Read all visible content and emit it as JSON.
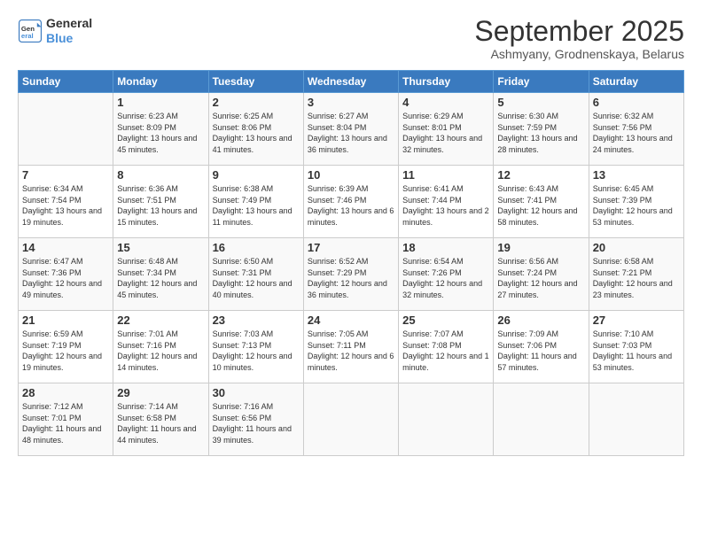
{
  "logo": {
    "line1": "General",
    "line2": "Blue"
  },
  "title": "September 2025",
  "subtitle": "Ashmyany, Grodnenskaya, Belarus",
  "days_of_week": [
    "Sunday",
    "Monday",
    "Tuesday",
    "Wednesday",
    "Thursday",
    "Friday",
    "Saturday"
  ],
  "weeks": [
    [
      {
        "day": "",
        "sunrise": "",
        "sunset": "",
        "daylight": ""
      },
      {
        "day": "1",
        "sunrise": "6:23 AM",
        "sunset": "8:09 PM",
        "daylight": "13 hours and 45 minutes."
      },
      {
        "day": "2",
        "sunrise": "6:25 AM",
        "sunset": "8:06 PM",
        "daylight": "13 hours and 41 minutes."
      },
      {
        "day": "3",
        "sunrise": "6:27 AM",
        "sunset": "8:04 PM",
        "daylight": "13 hours and 36 minutes."
      },
      {
        "day": "4",
        "sunrise": "6:29 AM",
        "sunset": "8:01 PM",
        "daylight": "13 hours and 32 minutes."
      },
      {
        "day": "5",
        "sunrise": "6:30 AM",
        "sunset": "7:59 PM",
        "daylight": "13 hours and 28 minutes."
      },
      {
        "day": "6",
        "sunrise": "6:32 AM",
        "sunset": "7:56 PM",
        "daylight": "13 hours and 24 minutes."
      }
    ],
    [
      {
        "day": "7",
        "sunrise": "6:34 AM",
        "sunset": "7:54 PM",
        "daylight": "13 hours and 19 minutes."
      },
      {
        "day": "8",
        "sunrise": "6:36 AM",
        "sunset": "7:51 PM",
        "daylight": "13 hours and 15 minutes."
      },
      {
        "day": "9",
        "sunrise": "6:38 AM",
        "sunset": "7:49 PM",
        "daylight": "13 hours and 11 minutes."
      },
      {
        "day": "10",
        "sunrise": "6:39 AM",
        "sunset": "7:46 PM",
        "daylight": "13 hours and 6 minutes."
      },
      {
        "day": "11",
        "sunrise": "6:41 AM",
        "sunset": "7:44 PM",
        "daylight": "13 hours and 2 minutes."
      },
      {
        "day": "12",
        "sunrise": "6:43 AM",
        "sunset": "7:41 PM",
        "daylight": "12 hours and 58 minutes."
      },
      {
        "day": "13",
        "sunrise": "6:45 AM",
        "sunset": "7:39 PM",
        "daylight": "12 hours and 53 minutes."
      }
    ],
    [
      {
        "day": "14",
        "sunrise": "6:47 AM",
        "sunset": "7:36 PM",
        "daylight": "12 hours and 49 minutes."
      },
      {
        "day": "15",
        "sunrise": "6:48 AM",
        "sunset": "7:34 PM",
        "daylight": "12 hours and 45 minutes."
      },
      {
        "day": "16",
        "sunrise": "6:50 AM",
        "sunset": "7:31 PM",
        "daylight": "12 hours and 40 minutes."
      },
      {
        "day": "17",
        "sunrise": "6:52 AM",
        "sunset": "7:29 PM",
        "daylight": "12 hours and 36 minutes."
      },
      {
        "day": "18",
        "sunrise": "6:54 AM",
        "sunset": "7:26 PM",
        "daylight": "12 hours and 32 minutes."
      },
      {
        "day": "19",
        "sunrise": "6:56 AM",
        "sunset": "7:24 PM",
        "daylight": "12 hours and 27 minutes."
      },
      {
        "day": "20",
        "sunrise": "6:58 AM",
        "sunset": "7:21 PM",
        "daylight": "12 hours and 23 minutes."
      }
    ],
    [
      {
        "day": "21",
        "sunrise": "6:59 AM",
        "sunset": "7:19 PM",
        "daylight": "12 hours and 19 minutes."
      },
      {
        "day": "22",
        "sunrise": "7:01 AM",
        "sunset": "7:16 PM",
        "daylight": "12 hours and 14 minutes."
      },
      {
        "day": "23",
        "sunrise": "7:03 AM",
        "sunset": "7:13 PM",
        "daylight": "12 hours and 10 minutes."
      },
      {
        "day": "24",
        "sunrise": "7:05 AM",
        "sunset": "7:11 PM",
        "daylight": "12 hours and 6 minutes."
      },
      {
        "day": "25",
        "sunrise": "7:07 AM",
        "sunset": "7:08 PM",
        "daylight": "12 hours and 1 minute."
      },
      {
        "day": "26",
        "sunrise": "7:09 AM",
        "sunset": "7:06 PM",
        "daylight": "11 hours and 57 minutes."
      },
      {
        "day": "27",
        "sunrise": "7:10 AM",
        "sunset": "7:03 PM",
        "daylight": "11 hours and 53 minutes."
      }
    ],
    [
      {
        "day": "28",
        "sunrise": "7:12 AM",
        "sunset": "7:01 PM",
        "daylight": "11 hours and 48 minutes."
      },
      {
        "day": "29",
        "sunrise": "7:14 AM",
        "sunset": "6:58 PM",
        "daylight": "11 hours and 44 minutes."
      },
      {
        "day": "30",
        "sunrise": "7:16 AM",
        "sunset": "6:56 PM",
        "daylight": "11 hours and 39 minutes."
      },
      {
        "day": "",
        "sunrise": "",
        "sunset": "",
        "daylight": ""
      },
      {
        "day": "",
        "sunrise": "",
        "sunset": "",
        "daylight": ""
      },
      {
        "day": "",
        "sunrise": "",
        "sunset": "",
        "daylight": ""
      },
      {
        "day": "",
        "sunrise": "",
        "sunset": "",
        "daylight": ""
      }
    ]
  ]
}
